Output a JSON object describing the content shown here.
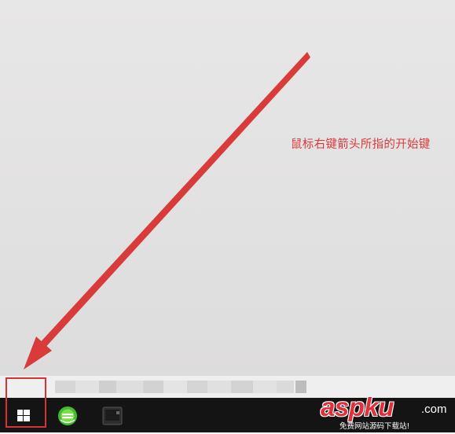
{
  "annotation": {
    "text": "鼠标右键箭头所指的开始键",
    "color": "#d93a3a"
  },
  "taskbar": {
    "background": "#141414",
    "start_button": {
      "icon": "windows-logo-icon"
    },
    "pinned_apps": [
      {
        "icon": "browser-icon",
        "color": "#3fbf2f"
      },
      {
        "icon": "media-app-icon",
        "color": "#2e2e2e"
      }
    ]
  },
  "highlight_color": "#d93232",
  "watermark": {
    "logo": "aspku",
    "suffix": ".com",
    "caption": "免费网站源码下载站!",
    "color": "#e0303a"
  }
}
